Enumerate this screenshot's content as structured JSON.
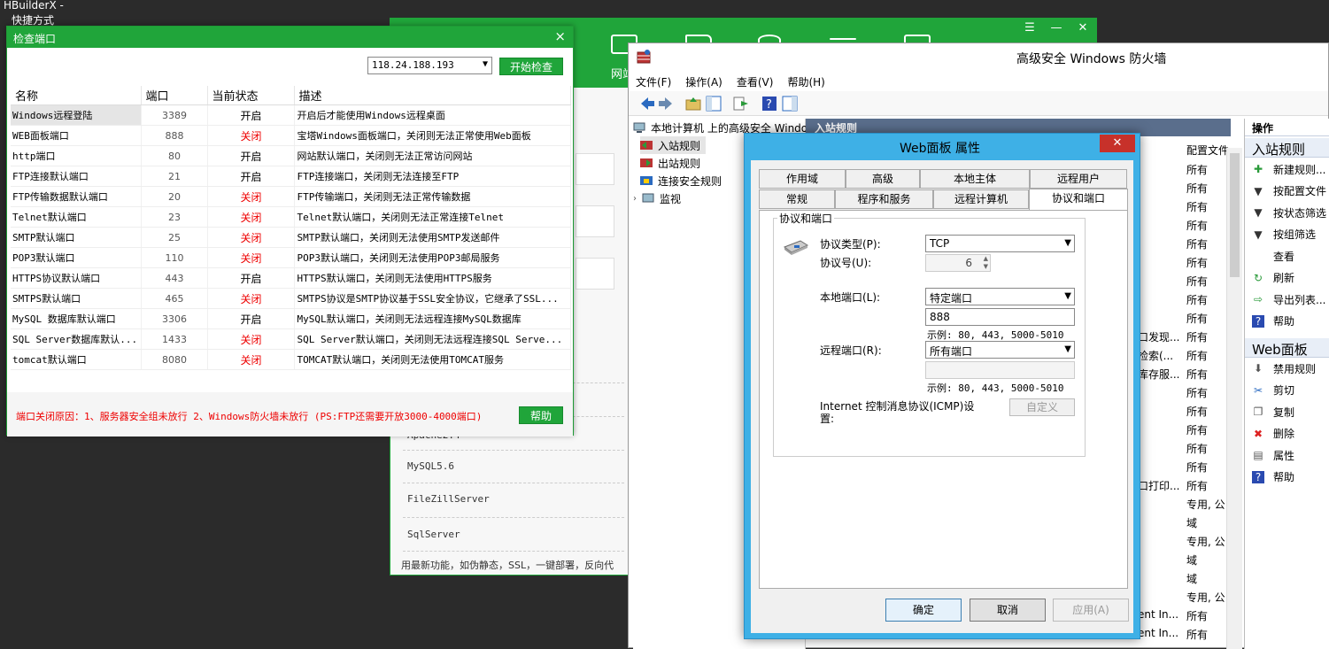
{
  "desktop": {
    "app_title": "HBuilderX -",
    "shortcut": "快捷方式"
  },
  "bt_panel": {
    "stub_text": "网站",
    "controls": [
      "☰",
      "—",
      "✕"
    ],
    "list_items": [
      "Apache2.4",
      "MySQL5.6",
      "FileZillServer",
      "SqlServer"
    ],
    "footer_note": "用最新功能，如伪静态，SSL，一键部署，反向代"
  },
  "ports_window": {
    "title": "检查端口",
    "close": "×",
    "ip_value": "118.24.188.193",
    "start_button": "开始检查",
    "columns": [
      "名称",
      "端口",
      "当前状态",
      "描述"
    ],
    "rows": [
      {
        "name": "Windows远程登陆",
        "port": "3389",
        "status": "开启",
        "desc": "开启后才能使用Windows远程桌面"
      },
      {
        "name": "WEB面板端口",
        "port": "888",
        "status": "关闭",
        "desc": "宝塔Windows面板端口，关闭则无法正常使用Web面板"
      },
      {
        "name": "http端口",
        "port": "80",
        "status": "开启",
        "desc": "网站默认端口，关闭则无法正常访问网站"
      },
      {
        "name": "FTP连接默认端口",
        "port": "21",
        "status": "开启",
        "desc": "FTP连接端口，关闭则无法连接至FTP"
      },
      {
        "name": "FTP传输数据默认端口",
        "port": "20",
        "status": "关闭",
        "desc": "FTP传输端口，关闭则无法正常传输数据"
      },
      {
        "name": "Telnet默认端口",
        "port": "23",
        "status": "关闭",
        "desc": "Telnet默认端口，关闭则无法正常连接Telnet"
      },
      {
        "name": "SMTP默认端口",
        "port": "25",
        "status": "关闭",
        "desc": "SMTP默认端口，关闭则无法使用SMTP发送邮件"
      },
      {
        "name": "POP3默认端口",
        "port": "110",
        "status": "关闭",
        "desc": "POP3默认端口，关闭则无法使用POP3邮局服务"
      },
      {
        "name": "HTTPS协议默认端口",
        "port": "443",
        "status": "开启",
        "desc": "HTTPS默认端口，关闭则无法使用HTTPS服务"
      },
      {
        "name": "SMTPS默认端口",
        "port": "465",
        "status": "关闭",
        "desc": "SMTPS协议是SMTP协议基于SSL安全协议，它继承了SSL..."
      },
      {
        "name": "MySQL 数据库默认端口",
        "port": "3306",
        "status": "开启",
        "desc": "MySQL默认端口，关闭则无法远程连接MySQL数据库"
      },
      {
        "name": "SQL Server数据库默认...",
        "port": "1433",
        "status": "关闭",
        "desc": "SQL Server默认端口，关闭则无法远程连接SQL Serve..."
      },
      {
        "name": "tomcat默认端口",
        "port": "8080",
        "status": "关闭",
        "desc": "TOMCAT默认端口，关闭则无法使用TOMCAT服务"
      }
    ],
    "reason": "端口关闭原因：1、服务器安全组未放行 2、Windows防火墙未放行 (PS:FTP还需要开放3000-4000端口)",
    "help_button": "帮助"
  },
  "firewall": {
    "title": "高级安全 Windows 防火墙",
    "menu": [
      "文件(F)",
      "操作(A)",
      "查看(V)",
      "帮助(H)"
    ],
    "tree_root": "本地计算机 上的高级安全 Windo",
    "tree_items": [
      "入站规则",
      "出站规则",
      "连接安全规则",
      "监视"
    ],
    "rules_header": "入站规则",
    "column_header": "配置文件",
    "column_values": [
      "所有",
      "所有",
      "所有",
      "所有",
      "所有",
      "所有",
      "所有",
      "所有",
      "所有",
      "所有",
      "所有",
      "所有",
      "所有",
      "所有",
      "所有",
      "所有",
      "所有",
      "所有",
      "专用, 公",
      "域",
      "专用, 公",
      "域",
      "域",
      "专用, 公",
      "所有",
      "所有"
    ],
    "fragments": [
      "口发现...",
      "检索(...",
      "库存服...",
      "口打印...",
      "ent In...",
      "ent In..."
    ],
    "actions_header": "操作",
    "section_inbound": "入站规则",
    "inbound_actions": [
      "新建规则...",
      "按配置文件",
      "按状态筛选",
      "按组筛选",
      "查看",
      "刷新",
      "导出列表...",
      "帮助"
    ],
    "section_web": "Web面板",
    "web_actions": [
      "禁用规则",
      "剪切",
      "复制",
      "删除",
      "属性",
      "帮助"
    ]
  },
  "dialog": {
    "title": "Web面板 属性",
    "close": "✕",
    "tabs_row1": [
      "作用域",
      "高级",
      "本地主体",
      "远程用户"
    ],
    "tabs_row2": [
      "常规",
      "程序和服务",
      "远程计算机",
      "协议和端口"
    ],
    "group_label": "协议和端口",
    "protocol_type_label": "协议类型(P):",
    "protocol_type_value": "TCP",
    "protocol_num_label": "协议号(U):",
    "protocol_num_value": "6",
    "local_port_label": "本地端口(L):",
    "local_port_mode": "特定端口",
    "local_port_value": "888",
    "local_example": "示例: 80, 443, 5000-5010",
    "remote_port_label": "远程端口(R):",
    "remote_port_mode": "所有端口",
    "remote_example": "示例: 80, 443, 5000-5010",
    "icmp_label": "Internet 控制消息协议(ICMP)设置:",
    "customize_button": "自定义",
    "ok_button": "确定",
    "cancel_button": "取消",
    "apply_button": "应用(A)"
  }
}
